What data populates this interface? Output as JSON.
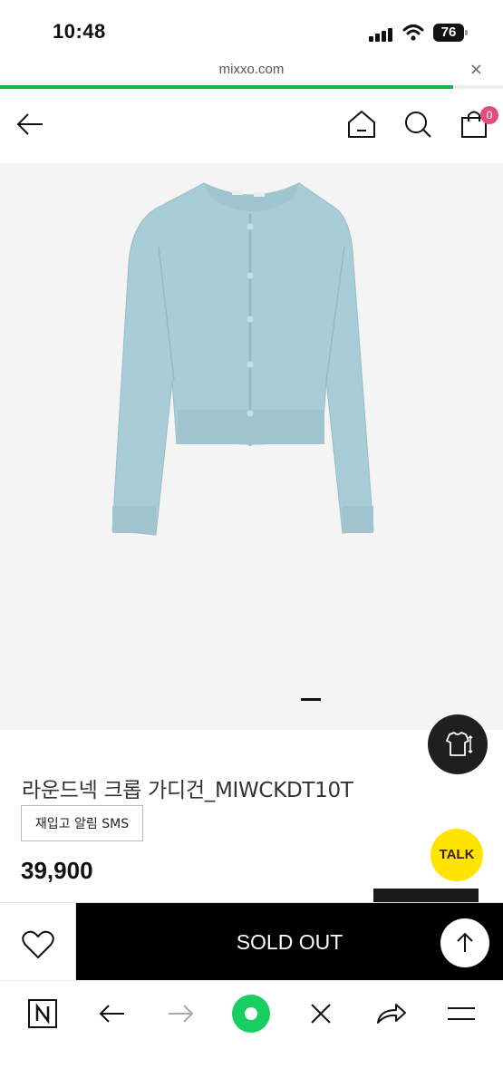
{
  "status_bar": {
    "time": "10:48",
    "battery": "76"
  },
  "browser": {
    "url": "mixxo.com",
    "close_label": "×",
    "load_progress": 0.9
  },
  "header": {
    "back_icon": "arrow-left-icon",
    "home_icon": "home-icon",
    "search_icon": "search-icon",
    "cart_icon": "shopping-bag-icon",
    "cart_count": "0",
    "badge_color": "#e0507a"
  },
  "product": {
    "image_description_icon": "cardigan-image",
    "name": "라운드넥 크롭 가디건_MIWCKDT10T",
    "restock_label": "재입고 알림 SMS",
    "price": "39,900",
    "garment_color": "#a9cdd6"
  },
  "floating": {
    "fit_icon": "clothing-size-icon",
    "kakao_label": "TALK",
    "top_icon": "arrow-up-icon"
  },
  "action_bar": {
    "wish_icon": "heart-icon",
    "soldout_label": "SOLD OUT"
  },
  "browser_nav": {
    "items": [
      "naver-n-icon",
      "back-arrow-icon",
      "forward-arrow-icon",
      "green-home-icon",
      "close-icon",
      "share-icon",
      "menu-icon"
    ],
    "accent": "#19ce60"
  }
}
